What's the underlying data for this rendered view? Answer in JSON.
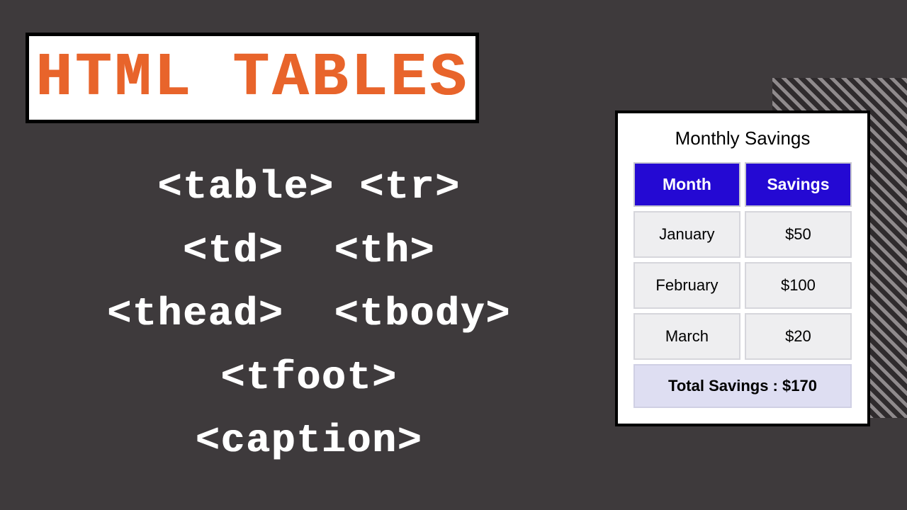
{
  "heading": "HTML TABLES",
  "tag_lines": [
    "<table> <tr>",
    "<td>  <th>",
    "<thead>  <tbody>",
    "<tfoot>",
    "<caption>"
  ],
  "table": {
    "caption": "Monthly Savings",
    "headers": [
      "Month",
      "Savings"
    ],
    "rows": [
      {
        "month": "January",
        "savings": "$50"
      },
      {
        "month": "February",
        "savings": "$100"
      },
      {
        "month": "March",
        "savings": "$20"
      }
    ],
    "footer": "Total Savings : $170"
  },
  "chart_data": {
    "type": "table",
    "title": "Monthly Savings",
    "columns": [
      "Month",
      "Savings"
    ],
    "rows": [
      [
        "January",
        50
      ],
      [
        "February",
        100
      ],
      [
        "March",
        20
      ]
    ],
    "total": 170,
    "currency": "$"
  }
}
